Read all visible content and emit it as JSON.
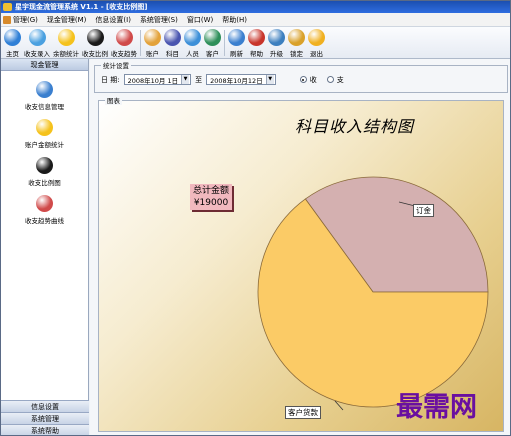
{
  "window": {
    "title": "星宇现金流管理系统 V1.1 - [收支比例图]"
  },
  "menu": {
    "items": [
      "管理(G)",
      "现金管理(M)",
      "信息设置(I)",
      "系统管理(S)",
      "窗口(W)",
      "帮助(H)"
    ]
  },
  "toolbar": {
    "buttons": [
      {
        "label": "主页",
        "icon": "home-icon",
        "color": "#2f7fd6"
      },
      {
        "label": "收支录入",
        "icon": "entry-icon",
        "color": "#4aa0e0"
      },
      {
        "label": "余额统计",
        "icon": "star-icon",
        "color": "#f5c21c"
      },
      {
        "label": "收支比例",
        "icon": "radiation-icon",
        "color": "#1a1a1a"
      },
      {
        "label": "收支趋势",
        "icon": "trend-icon",
        "color": "#d04a4a"
      },
      {
        "label": "账户",
        "icon": "account-icon",
        "color": "#e3a23a"
      },
      {
        "label": "科目",
        "icon": "subject-icon",
        "color": "#4a55b0"
      },
      {
        "label": "人员",
        "icon": "people-icon",
        "color": "#3c8fd8"
      },
      {
        "label": "客户",
        "icon": "customer-icon",
        "color": "#2e8f5a"
      },
      {
        "label": "刷新",
        "icon": "refresh-icon",
        "color": "#3a7fcf"
      },
      {
        "label": "帮助",
        "icon": "help-icon",
        "color": "#c8352b"
      },
      {
        "label": "升级",
        "icon": "upgrade-icon",
        "color": "#3c7fbf"
      },
      {
        "label": "锁定",
        "icon": "lock-icon",
        "color": "#d9a12a"
      },
      {
        "label": "退出",
        "icon": "exit-icon",
        "color": "#f0b020"
      }
    ]
  },
  "sidebar": {
    "header": "现金管理",
    "items": [
      {
        "label": "收支信息管理",
        "icon": "info-icon",
        "color": "#3a7fcf"
      },
      {
        "label": "账户金额统计",
        "icon": "star-icon",
        "color": "#f5c21c"
      },
      {
        "label": "收支比例图",
        "icon": "radiation-icon",
        "color": "#1a1a1a"
      },
      {
        "label": "收支趋势曲线",
        "icon": "trend-icon",
        "color": "#d04a4a"
      }
    ],
    "bottom_tabs": [
      "信息设置",
      "系统管理",
      "系统帮助"
    ]
  },
  "filter": {
    "group_title": "统计设置",
    "date_label": "日  期:",
    "date_from": "2008年10月 1日",
    "to_label": "至",
    "date_to": "2008年10月12日",
    "radio_income": "收",
    "radio_expense": "支",
    "selected": "收"
  },
  "chart": {
    "group_title": "图表",
    "title": "科目收入结构图",
    "total_label": "总计金额",
    "total_value": "¥19000"
  },
  "chart_data": {
    "type": "pie",
    "title": "科目收入结构图",
    "slices": [
      {
        "label": "订金",
        "value": 0.35,
        "color": "#d4b0b0"
      },
      {
        "label": "客户货款",
        "value": 0.65,
        "color": "#fbcb66"
      }
    ]
  },
  "watermark": "最需网"
}
